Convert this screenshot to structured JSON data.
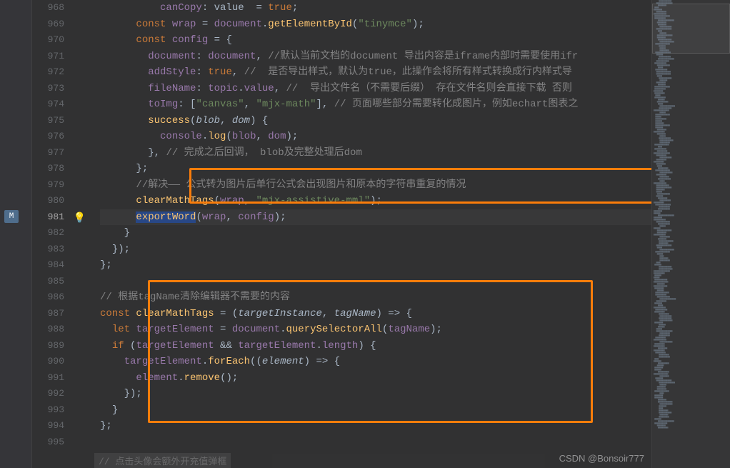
{
  "watermark": "CSDN @Bonsoir777",
  "leftMarker": "M",
  "bottomHint": "// 点击头像会额外开充值弹框",
  "lineStart": 968,
  "currentLine": 981,
  "lines": [
    {
      "n": 968,
      "indent": 5,
      "tokens": [
        [
          "prop",
          "canCopy"
        ],
        [
          "punct",
          ": value  = "
        ],
        [
          "bool",
          "true"
        ],
        [
          "punct",
          ";"
        ]
      ]
    },
    {
      "n": 969,
      "indent": 3,
      "tokens": [
        [
          "kw",
          "const "
        ],
        [
          "prop",
          "wrap"
        ],
        [
          "punct",
          " = "
        ],
        [
          "prop",
          "document"
        ],
        [
          "punct",
          "."
        ],
        [
          "fn",
          "getElementById"
        ],
        [
          "punct",
          "("
        ],
        [
          "str",
          "\"tinymce\""
        ],
        [
          "punct",
          ");"
        ]
      ]
    },
    {
      "n": 970,
      "indent": 3,
      "tokens": [
        [
          "kw",
          "const "
        ],
        [
          "prop",
          "config"
        ],
        [
          "punct",
          " = {"
        ]
      ]
    },
    {
      "n": 971,
      "indent": 4,
      "tokens": [
        [
          "prop",
          "document"
        ],
        [
          "punct",
          ": "
        ],
        [
          "prop",
          "document"
        ],
        [
          "punct",
          ", "
        ],
        [
          "comment",
          "//默认当前文档的document 导出内容是iframe内部时需要使用ifr"
        ]
      ]
    },
    {
      "n": 972,
      "indent": 4,
      "tokens": [
        [
          "prop",
          "addStyle"
        ],
        [
          "punct",
          ": "
        ],
        [
          "bool",
          "true"
        ],
        [
          "punct",
          ", "
        ],
        [
          "comment",
          "//  是否导出样式，默认为true，此操作会将所有样式转换成行内样式导"
        ]
      ]
    },
    {
      "n": 973,
      "indent": 4,
      "tokens": [
        [
          "prop",
          "fileName"
        ],
        [
          "punct",
          ": "
        ],
        [
          "prop",
          "topic"
        ],
        [
          "punct",
          "."
        ],
        [
          "prop",
          "value"
        ],
        [
          "punct",
          ", "
        ],
        [
          "comment",
          "//  导出文件名（不需要后缀） 存在文件名则会直接下载 否则"
        ]
      ]
    },
    {
      "n": 974,
      "indent": 4,
      "tokens": [
        [
          "prop",
          "toImg"
        ],
        [
          "punct",
          ": ["
        ],
        [
          "str",
          "\"canvas\""
        ],
        [
          "punct",
          ", "
        ],
        [
          "str",
          "\"mjx-math\""
        ],
        [
          "punct",
          "], "
        ],
        [
          "comment",
          "// 页面哪些部分需要转化成图片，例如echart图表之"
        ]
      ]
    },
    {
      "n": 975,
      "indent": 4,
      "tokens": [
        [
          "fn",
          "success"
        ],
        [
          "punct",
          "("
        ],
        [
          "param",
          "blob"
        ],
        [
          "punct",
          ", "
        ],
        [
          "param",
          "dom"
        ],
        [
          "punct",
          ") {"
        ]
      ]
    },
    {
      "n": 976,
      "indent": 5,
      "tokens": [
        [
          "prop",
          "console"
        ],
        [
          "punct",
          "."
        ],
        [
          "fn",
          "log"
        ],
        [
          "punct",
          "("
        ],
        [
          "prop",
          "blob"
        ],
        [
          "punct",
          ", "
        ],
        [
          "prop",
          "dom"
        ],
        [
          "punct",
          ");"
        ]
      ]
    },
    {
      "n": 977,
      "indent": 4,
      "tokens": [
        [
          "punct",
          "}, "
        ],
        [
          "comment",
          "// 完成之后回调， blob及完整处理后dom"
        ]
      ]
    },
    {
      "n": 978,
      "indent": 3,
      "tokens": [
        [
          "punct",
          "};"
        ]
      ]
    },
    {
      "n": 979,
      "indent": 3,
      "tokens": [
        [
          "comment",
          "//解决—— 公式转为图片后单行公式会出现图片和原本的字符串重复的情况"
        ]
      ]
    },
    {
      "n": 980,
      "indent": 3,
      "tokens": [
        [
          "fn",
          "clearMathTags"
        ],
        [
          "punct",
          "("
        ],
        [
          "prop",
          "wrap"
        ],
        [
          "punct",
          ", "
        ],
        [
          "str",
          "\"mjx-assistive-mml\""
        ],
        [
          "punct",
          ");"
        ]
      ]
    },
    {
      "n": 981,
      "indent": 3,
      "current": true,
      "tokens": [
        [
          "fn hl",
          "exportWord"
        ],
        [
          "punct",
          "("
        ],
        [
          "prop",
          "wrap"
        ],
        [
          "punct",
          ", "
        ],
        [
          "prop",
          "config"
        ],
        [
          "punct",
          ");"
        ]
      ]
    },
    {
      "n": 982,
      "indent": 2,
      "tokens": [
        [
          "punct",
          "}"
        ]
      ]
    },
    {
      "n": 983,
      "indent": 1,
      "tokens": [
        [
          "punct",
          "});"
        ]
      ]
    },
    {
      "n": 984,
      "indent": 0,
      "tokens": [
        [
          "punct",
          "};"
        ]
      ]
    },
    {
      "n": 985,
      "indent": 0,
      "tokens": []
    },
    {
      "n": 986,
      "indent": 0,
      "tokens": [
        [
          "comment",
          "// 根据tagName清除编辑器不需要的内容"
        ]
      ]
    },
    {
      "n": 987,
      "indent": 0,
      "tokens": [
        [
          "kw",
          "const "
        ],
        [
          "fn",
          "clearMathTags"
        ],
        [
          "punct",
          " = ("
        ],
        [
          "param",
          "targetInstance"
        ],
        [
          "punct",
          ", "
        ],
        [
          "param",
          "tagName"
        ],
        [
          "punct",
          ") => {"
        ]
      ]
    },
    {
      "n": 988,
      "indent": 1,
      "tokens": [
        [
          "kw",
          "let "
        ],
        [
          "prop",
          "targetElement"
        ],
        [
          "punct",
          " = "
        ],
        [
          "prop",
          "document"
        ],
        [
          "punct",
          "."
        ],
        [
          "fn",
          "querySelectorAll"
        ],
        [
          "punct",
          "("
        ],
        [
          "prop",
          "tagName"
        ],
        [
          "punct",
          ");"
        ]
      ]
    },
    {
      "n": 989,
      "indent": 1,
      "tokens": [
        [
          "kw",
          "if"
        ],
        [
          "punct",
          " ("
        ],
        [
          "prop",
          "targetElement"
        ],
        [
          "punct",
          " && "
        ],
        [
          "prop",
          "targetElement"
        ],
        [
          "punct",
          "."
        ],
        [
          "prop",
          "length"
        ],
        [
          "punct",
          ") {"
        ]
      ]
    },
    {
      "n": 990,
      "indent": 2,
      "tokens": [
        [
          "prop",
          "targetElement"
        ],
        [
          "punct",
          "."
        ],
        [
          "fn",
          "forEach"
        ],
        [
          "punct",
          "(("
        ],
        [
          "param",
          "element"
        ],
        [
          "punct",
          ") => {"
        ]
      ]
    },
    {
      "n": 991,
      "indent": 3,
      "tokens": [
        [
          "prop",
          "element"
        ],
        [
          "punct",
          "."
        ],
        [
          "fn",
          "remove"
        ],
        [
          "punct",
          "();"
        ]
      ]
    },
    {
      "n": 992,
      "indent": 2,
      "tokens": [
        [
          "punct",
          "});"
        ]
      ]
    },
    {
      "n": 993,
      "indent": 1,
      "tokens": [
        [
          "punct",
          "}"
        ]
      ]
    },
    {
      "n": 994,
      "indent": 0,
      "tokens": [
        [
          "punct",
          "};"
        ]
      ]
    },
    {
      "n": 995,
      "indent": 0,
      "tokens": []
    }
  ]
}
